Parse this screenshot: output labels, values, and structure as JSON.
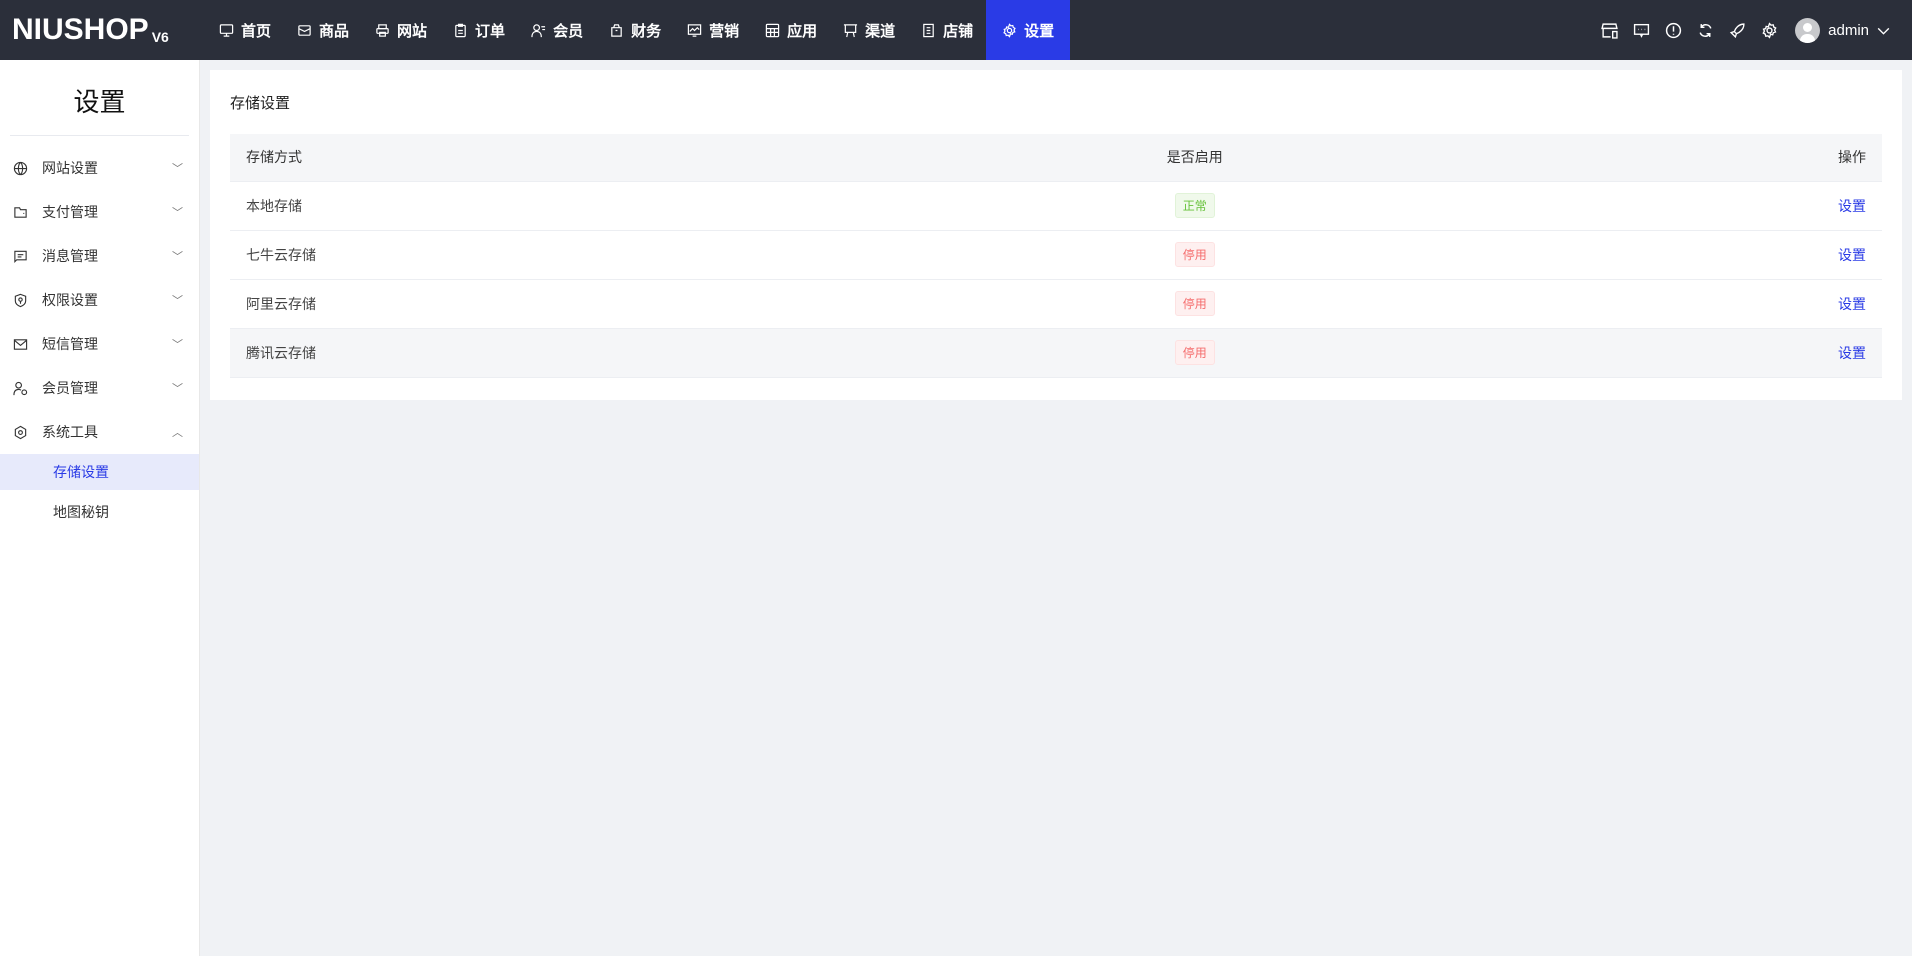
{
  "brand": {
    "name": "NIUSHOP",
    "version": "V6"
  },
  "nav": [
    {
      "label": "首页",
      "icon": "monitor-icon"
    },
    {
      "label": "商品",
      "icon": "box-icon"
    },
    {
      "label": "网站",
      "icon": "printer-icon"
    },
    {
      "label": "订单",
      "icon": "clipboard-icon"
    },
    {
      "label": "会员",
      "icon": "user-icon"
    },
    {
      "label": "财务",
      "icon": "bag-icon"
    },
    {
      "label": "营销",
      "icon": "chart-icon"
    },
    {
      "label": "应用",
      "icon": "grid-icon"
    },
    {
      "label": "渠道",
      "icon": "easel-icon"
    },
    {
      "label": "店铺",
      "icon": "document-icon"
    },
    {
      "label": "设置",
      "icon": "gear-icon",
      "active": true
    }
  ],
  "user": {
    "name": "admin"
  },
  "sidebar": {
    "title": "设置",
    "items": [
      {
        "label": "网站设置"
      },
      {
        "label": "支付管理"
      },
      {
        "label": "消息管理"
      },
      {
        "label": "权限设置"
      },
      {
        "label": "短信管理"
      },
      {
        "label": "会员管理"
      },
      {
        "label": "系统工具"
      }
    ],
    "sub": [
      {
        "label": "存储设置",
        "active": true
      },
      {
        "label": "地图秘钥"
      }
    ]
  },
  "page": {
    "title": "存储设置",
    "columns": [
      "存储方式",
      "是否启用",
      "操作"
    ],
    "rows": [
      {
        "name": "本地存储",
        "status": "正常",
        "action": "设置"
      },
      {
        "name": "七牛云存储",
        "status": "停用",
        "action": "设置"
      },
      {
        "name": "阿里云存储",
        "status": "停用",
        "action": "设置"
      },
      {
        "name": "腾讯云存储",
        "status": "停用",
        "action": "设置"
      }
    ]
  },
  "colors": {
    "accent": "#2a3be6",
    "topbar": "#2b2f3a",
    "ok": "#67c23a",
    "off": "#f56c6c"
  }
}
